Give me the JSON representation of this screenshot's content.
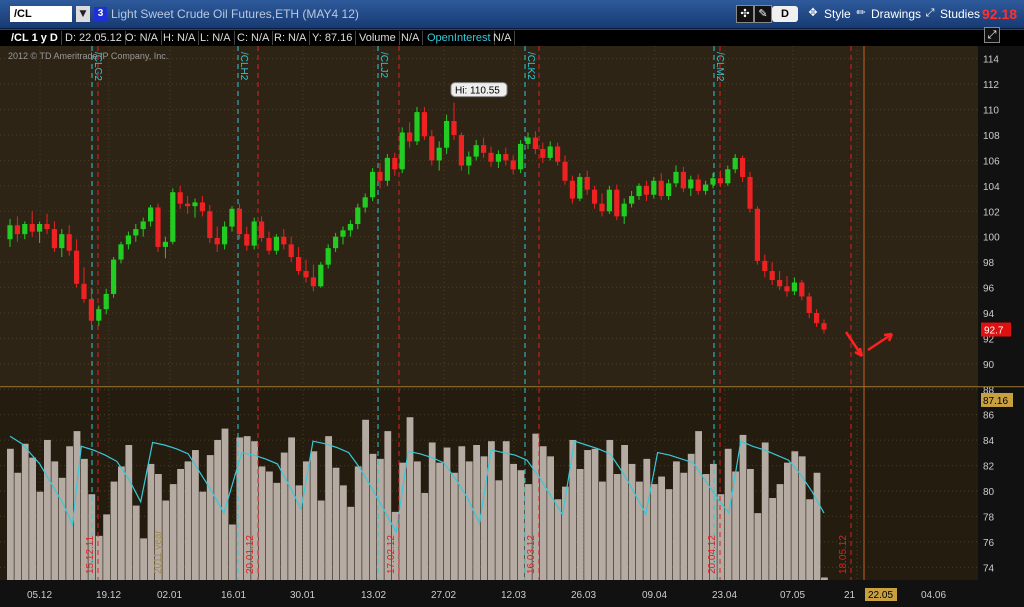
{
  "header": {
    "symbol": "/CL",
    "link_number": "3",
    "instrument_title": "Light Sweet Crude Oil Futures,ETH (MAY4 12)",
    "d_label": "D",
    "style_label": "Style",
    "drawings_label": "Drawings",
    "studies_label": "Studies",
    "last_price": "92.18"
  },
  "infobar": {
    "period": "/CL 1 y D",
    "date": "D: 22.05.12",
    "open": "O: N/A",
    "high": "H: N/A",
    "low": "L: N/A",
    "close": "C: N/A",
    "range": "R: N/A",
    "y": "Y: 87.16",
    "volume_label": "Volume",
    "volume_value": "N/A",
    "oi_label": "OpenInterest",
    "oi_value": "N/A"
  },
  "colors": {
    "up": "#22cc22",
    "down": "#ee2222",
    "volume": "#b5aba3",
    "open_interest": "#38c8d8",
    "price_bg": "#2d2416",
    "volume_bg": "#231c0f",
    "grid": "#4a3e28",
    "expiry": "#30c8d8",
    "marker": "#e02020"
  },
  "chart_data": {
    "type": "candlestick",
    "copyright": "2012 © TD Ameritrade IP Company, Inc.",
    "y_ticks": [
      74,
      76,
      78,
      80,
      82,
      84,
      86,
      88,
      90,
      92,
      94,
      96,
      98,
      100,
      102,
      104,
      106,
      108,
      110,
      112,
      114
    ],
    "ylim": [
      73,
      115
    ],
    "x_labels": [
      "05.12",
      "19.12",
      "02.01",
      "16.01",
      "30.01",
      "13.02",
      "27.02",
      "12.03",
      "26.03",
      "09.04",
      "23.04",
      "07.05",
      "21",
      "22.05",
      "04.06"
    ],
    "current_date_label": "22.05",
    "hi_label": "Hi: 110.55",
    "price_label": "92.7",
    "cursor_label": "87.16",
    "year_label": "2011 year",
    "expiry_labels": [
      "/CLG2",
      "/CLH2",
      "/CLJ2",
      "/CLK2",
      "/CLM2"
    ],
    "marker_labels": [
      "15.12.11",
      "20.01.12",
      "17.02.12",
      "16.03.12",
      "20.04.12",
      "18.05.12"
    ],
    "candles_ohlc": [
      [
        99.8,
        101.4,
        99.2,
        100.9
      ],
      [
        100.9,
        101.6,
        99.6,
        100.2
      ],
      [
        100.2,
        101.2,
        99.8,
        101.0
      ],
      [
        101.0,
        102.0,
        100.0,
        100.4
      ],
      [
        100.4,
        101.2,
        99.5,
        101.0
      ],
      [
        101.0,
        101.8,
        100.2,
        100.6
      ],
      [
        100.6,
        101.2,
        98.8,
        99.1
      ],
      [
        99.1,
        100.6,
        98.4,
        100.2
      ],
      [
        100.2,
        100.9,
        98.5,
        98.9
      ],
      [
        98.9,
        99.8,
        96.0,
        96.3
      ],
      [
        96.3,
        97.6,
        94.8,
        95.1
      ],
      [
        95.1,
        96.0,
        93.0,
        93.4
      ],
      [
        93.4,
        94.6,
        93.0,
        94.3
      ],
      [
        94.3,
        95.9,
        93.9,
        95.5
      ],
      [
        95.5,
        98.4,
        95.2,
        98.2
      ],
      [
        98.2,
        99.6,
        97.9,
        99.4
      ],
      [
        99.4,
        100.4,
        99.0,
        100.1
      ],
      [
        100.1,
        101.0,
        99.6,
        100.6
      ],
      [
        100.6,
        101.5,
        100.0,
        101.2
      ],
      [
        101.2,
        102.5,
        100.8,
        102.3
      ],
      [
        102.3,
        102.6,
        98.8,
        99.2
      ],
      [
        99.2,
        100.0,
        98.3,
        99.6
      ],
      [
        99.6,
        103.8,
        99.4,
        103.5
      ],
      [
        103.5,
        104.0,
        102.2,
        102.6
      ],
      [
        102.6,
        103.2,
        101.8,
        102.4
      ],
      [
        102.4,
        103.0,
        101.5,
        102.7
      ],
      [
        102.7,
        103.2,
        101.6,
        102.0
      ],
      [
        102.0,
        102.5,
        99.5,
        99.9
      ],
      [
        99.9,
        100.8,
        98.8,
        99.4
      ],
      [
        99.4,
        101.2,
        99.0,
        100.8
      ],
      [
        100.8,
        102.4,
        100.4,
        102.2
      ],
      [
        102.2,
        102.6,
        99.8,
        100.2
      ],
      [
        100.2,
        100.8,
        98.9,
        99.3
      ],
      [
        99.3,
        101.5,
        99.0,
        101.2
      ],
      [
        101.2,
        101.6,
        99.6,
        99.9
      ],
      [
        99.9,
        100.4,
        98.6,
        98.9
      ],
      [
        98.9,
        100.2,
        98.6,
        100.0
      ],
      [
        100.0,
        100.6,
        99.0,
        99.4
      ],
      [
        99.4,
        100.0,
        98.0,
        98.4
      ],
      [
        98.4,
        99.2,
        97.0,
        97.3
      ],
      [
        97.3,
        98.2,
        96.4,
        96.8
      ],
      [
        96.8,
        97.8,
        95.7,
        96.1
      ],
      [
        96.1,
        98.0,
        96.0,
        97.8
      ],
      [
        97.8,
        99.4,
        97.5,
        99.1
      ],
      [
        99.1,
        100.3,
        98.8,
        100.0
      ],
      [
        100.0,
        100.8,
        99.4,
        100.5
      ],
      [
        100.5,
        101.3,
        100.0,
        101.0
      ],
      [
        101.0,
        102.6,
        100.6,
        102.3
      ],
      [
        102.3,
        103.4,
        101.9,
        103.1
      ],
      [
        103.1,
        105.4,
        102.8,
        105.1
      ],
      [
        105.1,
        105.8,
        103.8,
        104.4
      ],
      [
        104.4,
        106.5,
        104.0,
        106.2
      ],
      [
        106.2,
        106.6,
        104.8,
        105.3
      ],
      [
        105.3,
        108.6,
        105.0,
        108.2
      ],
      [
        108.2,
        109.0,
        107.0,
        107.5
      ],
      [
        107.5,
        110.2,
        107.2,
        109.8
      ],
      [
        109.8,
        110.2,
        107.6,
        107.9
      ],
      [
        107.9,
        108.4,
        105.6,
        106.0
      ],
      [
        106.0,
        107.5,
        105.2,
        107.0
      ],
      [
        107.0,
        109.6,
        106.5,
        109.1
      ],
      [
        109.1,
        110.55,
        107.6,
        108.0
      ],
      [
        108.0,
        108.2,
        105.2,
        105.6
      ],
      [
        105.6,
        106.7,
        104.9,
        106.3
      ],
      [
        106.3,
        107.6,
        106.0,
        107.2
      ],
      [
        107.2,
        107.8,
        106.2,
        106.6
      ],
      [
        106.6,
        107.1,
        105.5,
        105.9
      ],
      [
        105.9,
        106.8,
        105.4,
        106.5
      ],
      [
        106.5,
        107.0,
        105.6,
        106.0
      ],
      [
        106.0,
        106.4,
        104.9,
        105.3
      ],
      [
        105.3,
        107.6,
        105.0,
        107.3
      ],
      [
        107.3,
        108.2,
        106.9,
        107.8
      ],
      [
        107.8,
        108.3,
        106.5,
        106.9
      ],
      [
        106.9,
        107.4,
        105.8,
        106.2
      ],
      [
        106.2,
        107.5,
        106.0,
        107.1
      ],
      [
        107.1,
        107.4,
        105.6,
        105.9
      ],
      [
        105.9,
        106.4,
        104.1,
        104.4
      ],
      [
        104.4,
        104.8,
        102.6,
        103.0
      ],
      [
        103.0,
        105.0,
        102.8,
        104.7
      ],
      [
        104.7,
        105.2,
        103.3,
        103.7
      ],
      [
        103.7,
        104.0,
        102.2,
        102.6
      ],
      [
        102.6,
        103.4,
        101.6,
        102.0
      ],
      [
        102.0,
        104.0,
        101.8,
        103.7
      ],
      [
        103.7,
        104.1,
        101.3,
        101.6
      ],
      [
        101.6,
        103.0,
        101.0,
        102.6
      ],
      [
        102.6,
        103.6,
        102.3,
        103.2
      ],
      [
        103.2,
        104.2,
        102.9,
        104.0
      ],
      [
        104.0,
        104.4,
        102.8,
        103.3
      ],
      [
        103.3,
        104.7,
        103.0,
        104.4
      ],
      [
        104.4,
        105.0,
        102.9,
        103.2
      ],
      [
        103.2,
        104.5,
        102.9,
        104.2
      ],
      [
        104.2,
        105.6,
        103.9,
        105.1
      ],
      [
        105.1,
        105.5,
        103.5,
        103.8
      ],
      [
        103.8,
        104.8,
        103.2,
        104.5
      ],
      [
        104.5,
        104.9,
        103.3,
        103.6
      ],
      [
        103.6,
        104.4,
        103.3,
        104.1
      ],
      [
        104.1,
        105.0,
        103.8,
        104.6
      ],
      [
        104.6,
        105.2,
        103.9,
        104.2
      ],
      [
        104.2,
        105.6,
        104.0,
        105.3
      ],
      [
        105.3,
        106.5,
        105.0,
        106.2
      ],
      [
        106.2,
        106.4,
        104.3,
        104.7
      ],
      [
        104.7,
        105.1,
        101.9,
        102.2
      ],
      [
        102.2,
        102.4,
        97.8,
        98.1
      ],
      [
        98.1,
        98.6,
        96.8,
        97.3
      ],
      [
        97.3,
        98.0,
        96.2,
        96.6
      ],
      [
        96.6,
        97.3,
        95.8,
        96.1
      ],
      [
        96.1,
        96.9,
        95.3,
        95.7
      ],
      [
        95.7,
        96.8,
        95.4,
        96.4
      ],
      [
        96.4,
        96.6,
        95.0,
        95.3
      ],
      [
        95.3,
        95.6,
        93.6,
        94.0
      ],
      [
        94.0,
        94.3,
        92.9,
        93.2
      ],
      [
        93.2,
        93.5,
        92.4,
        92.7
      ]
    ],
    "volume_ylim": [
      73,
      88
    ],
    "volume_values": [
      83.4,
      81.5,
      83.8,
      82.7,
      80.0,
      84.1,
      82.4,
      81.1,
      83.6,
      84.8,
      82.6,
      79.8,
      76.5,
      78.2,
      80.8,
      82.0,
      83.7,
      78.9,
      76.3,
      82.2,
      81.4,
      79.3,
      80.6,
      81.8,
      82.4,
      83.3,
      80.0,
      82.9,
      84.1,
      85.0,
      77.4,
      84.3,
      84.4,
      84.0,
      82.0,
      81.6,
      80.7,
      83.1,
      84.3,
      80.5,
      82.4,
      83.2,
      79.3,
      84.4,
      81.9,
      80.5,
      78.8,
      82.0,
      85.7,
      83.0,
      82.6,
      84.8,
      78.4,
      82.3,
      85.9,
      82.4,
      79.9,
      83.9,
      82.3,
      83.5,
      81.5,
      83.6,
      82.4,
      83.7,
      82.8,
      84.0,
      80.9,
      84.0,
      82.2,
      81.7,
      80.6,
      84.6,
      83.6,
      82.8,
      79.4,
      80.4,
      84.1,
      81.8,
      83.3,
      83.4,
      80.8,
      84.1,
      81.4,
      83.7,
      82.2,
      80.8,
      82.6,
      80.6,
      81.2,
      80.2,
      82.4,
      81.5,
      83.0,
      84.8,
      81.4,
      82.2,
      79.8,
      83.4,
      81.6,
      84.5,
      81.8,
      78.3,
      83.9,
      79.5,
      80.6,
      82.3,
      83.2,
      82.8,
      79.4,
      81.5,
      73.2
    ],
    "open_interest": [
      84.4,
      83.8,
      82.2,
      80.6,
      79.0,
      77.4,
      83.6,
      83.3,
      82.9,
      82.4,
      81.0,
      79.2,
      83.9,
      83.7,
      83.4,
      83.0,
      81.5,
      80.0,
      78.3,
      83.1,
      82.9,
      82.6,
      82.2,
      80.5,
      78.6,
      84.0,
      83.8,
      83.5,
      83.1,
      81.8,
      80.2,
      78.5,
      76.8,
      83.2,
      83.0,
      82.7,
      82.3,
      81.0,
      79.5,
      77.5,
      83.3,
      83.1,
      82.9,
      82.5,
      81.2,
      79.7,
      78.2,
      84.0,
      83.7,
      83.4,
      83.0,
      81.6,
      80.0,
      78.2,
      83.1,
      82.9,
      82.6,
      82.3,
      80.9,
      79.5,
      78.3,
      84.0,
      83.6,
      83.3,
      82.9,
      82.5,
      81.4,
      80.0,
      78.3
    ],
    "oi_x": [
      0,
      2,
      5,
      7,
      9,
      10.5,
      12,
      14,
      16,
      18,
      20,
      22,
      24,
      26,
      28,
      30,
      32,
      34,
      36,
      39,
      41,
      43,
      45,
      47,
      49,
      51,
      53,
      55,
      57,
      59,
      61,
      63,
      65,
      67,
      69,
      71,
      73,
      75,
      77,
      79,
      81,
      83,
      85,
      87,
      89,
      91,
      93,
      95,
      97,
      99,
      101,
      103,
      105,
      107,
      109,
      111,
      113,
      115,
      117,
      119,
      121,
      123,
      125,
      127,
      129,
      131,
      133,
      135,
      137
    ]
  }
}
